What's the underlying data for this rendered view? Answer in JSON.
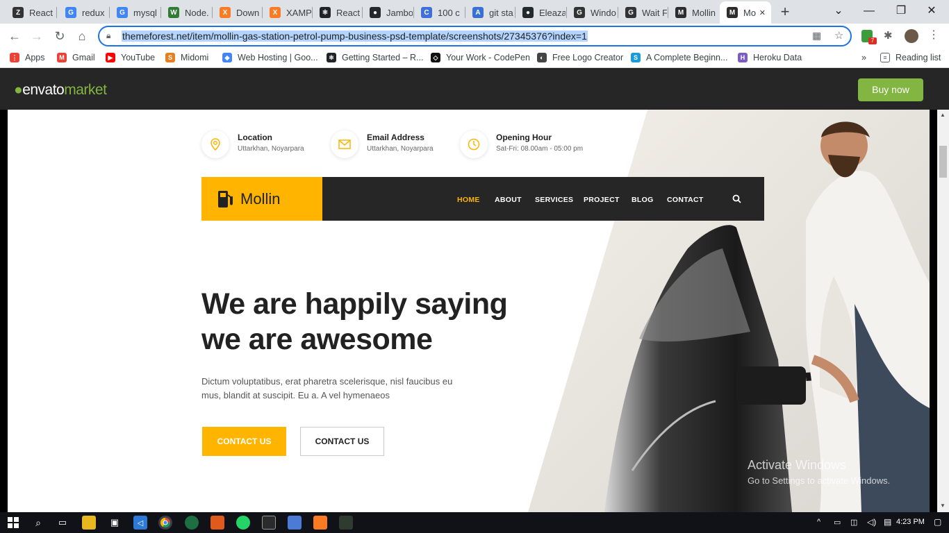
{
  "browser": {
    "tabs": [
      {
        "label": "React",
        "icon": "z-icon",
        "color": "#333333",
        "glyph": "Z"
      },
      {
        "label": "redux",
        "icon": "google-icon",
        "color": "#4285f4",
        "glyph": "G"
      },
      {
        "label": "mysql",
        "icon": "google-icon",
        "color": "#4285f4",
        "glyph": "G"
      },
      {
        "label": "Node.",
        "icon": "w-icon",
        "color": "#2e7d32",
        "glyph": "W"
      },
      {
        "label": "Down",
        "icon": "xampp-icon",
        "color": "#fb7a24",
        "glyph": "X"
      },
      {
        "label": "XAMP",
        "icon": "xampp-icon",
        "color": "#fb7a24",
        "glyph": "X"
      },
      {
        "label": "React",
        "icon": "react-icon",
        "color": "#20232a",
        "glyph": "⚛"
      },
      {
        "label": "Jambo",
        "icon": "github-icon",
        "color": "#24292e",
        "glyph": "●"
      },
      {
        "label": "100 c",
        "icon": "c-icon",
        "color": "#3f6fd8",
        "glyph": "C"
      },
      {
        "label": "git sta",
        "icon": "a-icon",
        "color": "#3b6fd8",
        "glyph": "A"
      },
      {
        "label": "Eleaza",
        "icon": "github-icon",
        "color": "#24292e",
        "glyph": "●"
      },
      {
        "label": "Windo",
        "icon": "g-icon",
        "color": "#333333",
        "glyph": "G"
      },
      {
        "label": "Wait F",
        "icon": "g-icon",
        "color": "#333333",
        "glyph": "G"
      },
      {
        "label": "Mollin",
        "icon": "mollin-icon",
        "color": "#2d2d2d",
        "glyph": "M"
      },
      {
        "label": "Mo",
        "icon": "mollin-icon",
        "color": "#2d2d2d",
        "glyph": "M"
      }
    ],
    "url": "themeforest.net/item/mollin-gas-station-petrol-pump-business-psd-template/screenshots/27345376?index=1",
    "bookmarks": [
      {
        "label": "Apps",
        "icon": "apps-grid-icon",
        "color": "#ea4335",
        "glyph": "⋮"
      },
      {
        "label": "Gmail",
        "icon": "gmail-icon",
        "color": "#ea4335",
        "glyph": "M"
      },
      {
        "label": "YouTube",
        "icon": "youtube-icon",
        "color": "#ff0000",
        "glyph": "▶"
      },
      {
        "label": "Midomi",
        "icon": "midomi-icon",
        "color": "#e67e22",
        "glyph": "S"
      },
      {
        "label": "Web Hosting | Goo...",
        "icon": "google-cloud-icon",
        "color": "#4285f4",
        "glyph": "◆"
      },
      {
        "label": "Getting Started – R...",
        "icon": "react-icon",
        "color": "#20232a",
        "glyph": "⚛"
      },
      {
        "label": "Your Work - CodePen",
        "icon": "codepen-icon",
        "color": "#111111",
        "glyph": "◇"
      },
      {
        "label": "Free Logo Creator",
        "icon": "logo-creator-icon",
        "color": "#444444",
        "glyph": "◐"
      },
      {
        "label": "A Complete Beginn...",
        "icon": "s-icon",
        "color": "#1a9ad6",
        "glyph": "S"
      },
      {
        "label": "Heroku Data",
        "icon": "heroku-icon",
        "color": "#7c5cbf",
        "glyph": "H"
      }
    ],
    "reading_list": "Reading list",
    "more_bookmarks": "»"
  },
  "envato": {
    "logo_main": "envato",
    "logo_market": "market",
    "buy_now": "Buy now"
  },
  "site": {
    "info": [
      {
        "title": "Location",
        "subtitle": "Uttarkhan, Noyarpara",
        "icon": "location-pin-icon"
      },
      {
        "title": "Email Address",
        "subtitle": "Uttarkhan, Noyarpara",
        "icon": "envelope-icon"
      },
      {
        "title": "Opening Hour",
        "subtitle": "Sat-Fri: 08.00am - 05:00 pm",
        "icon": "clock-icon"
      }
    ],
    "brand": "Mollin",
    "menu": [
      "HOME",
      "ABOUT",
      "SERVICES",
      "PROJECT",
      "BLOG",
      "CONTACT"
    ],
    "headline_line1": "We are happily saying",
    "headline_line2": "we are awesome",
    "description": "Dictum voluptatibus, erat pharetra scelerisque, nisl faucibus eu mus, blandit at suscipit. Eu a. A vel hymenaeos",
    "cta_primary": "CONTACT US",
    "cta_secondary": "CONTACT US",
    "accent": "#ffb400"
  },
  "overlay": {
    "activate_title": "Activate Windows",
    "activate_sub": "Go to Settings to activate Windows."
  },
  "taskbar": {
    "time": "4:23 PM"
  }
}
